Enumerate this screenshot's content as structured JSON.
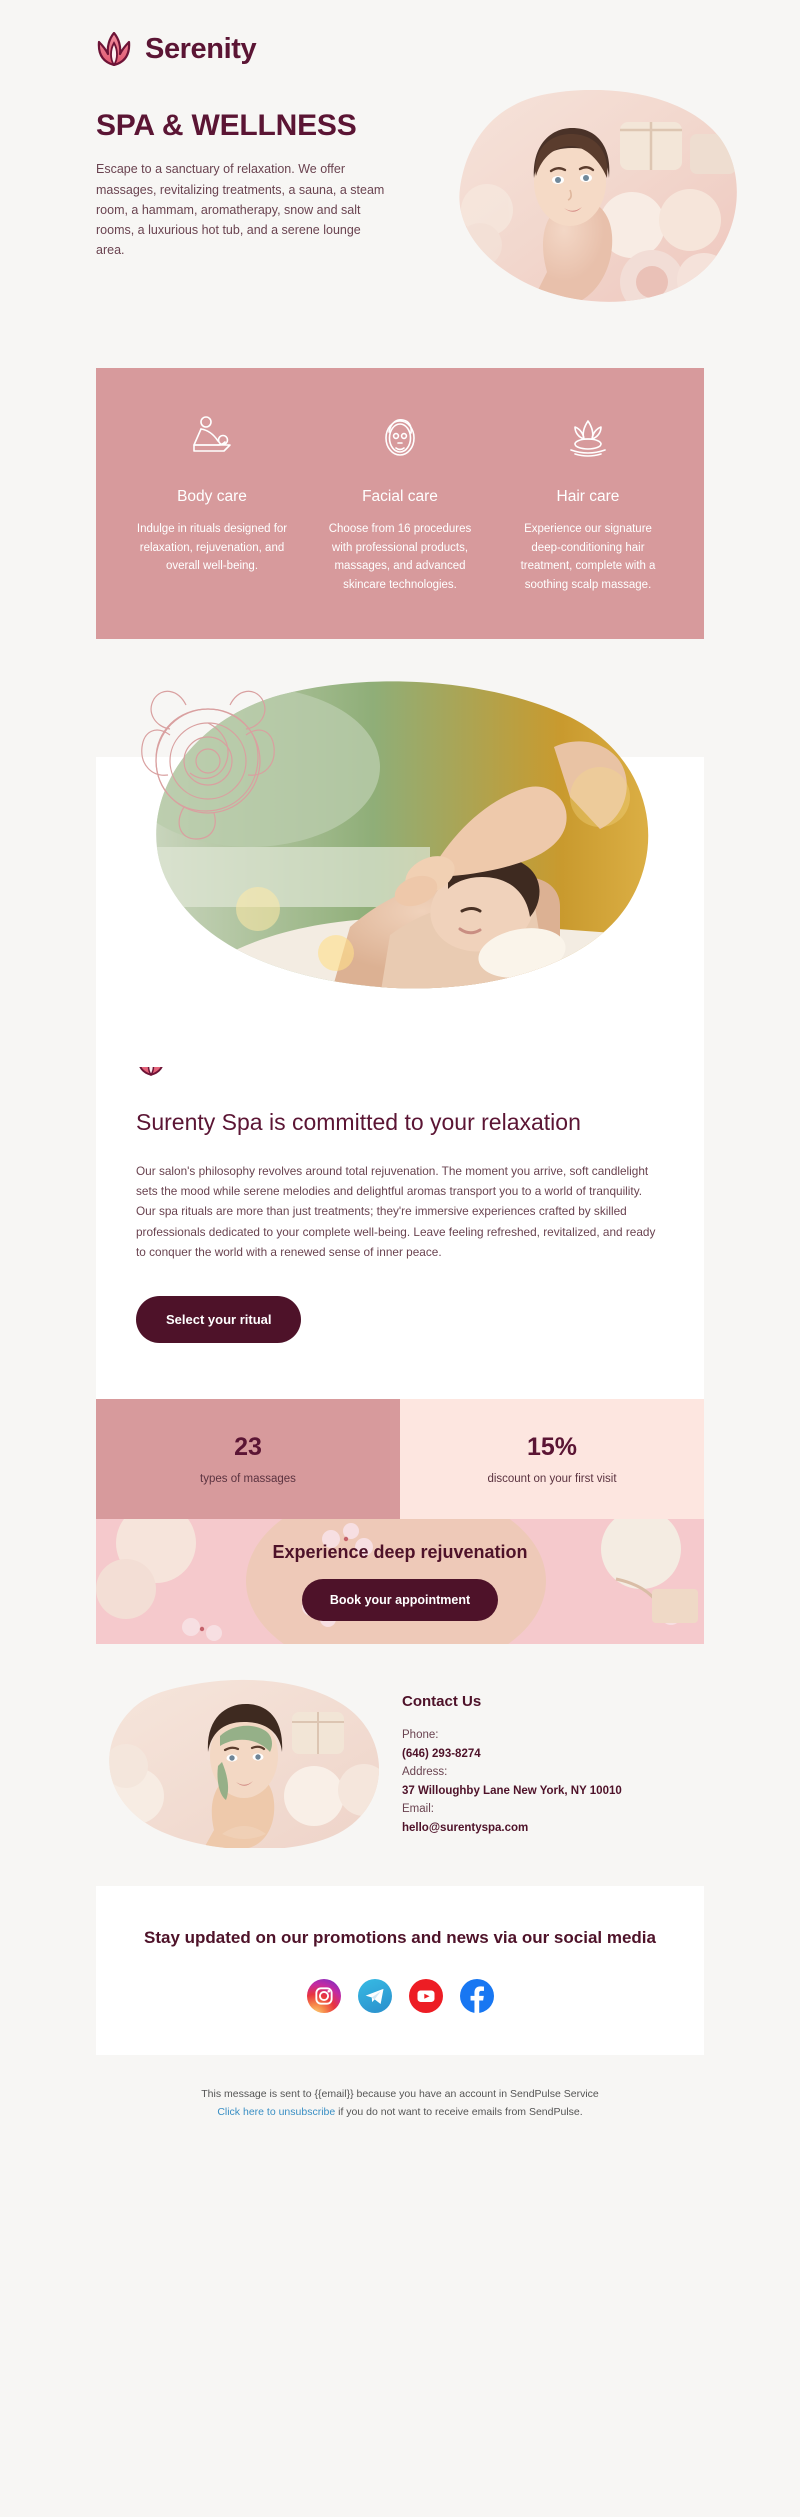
{
  "brand": {
    "name": "Serenity",
    "logo_icon": "lotus-icon",
    "accent": "#5b1534",
    "rose": "#d79a9c",
    "blush": "#fde6e0"
  },
  "hero": {
    "title": "SPA & WELLNESS",
    "text": "Escape to a sanctuary of relaxation. We offer massages, revitalizing treatments, a sauna, a steam room, a hammam, aromatherapy, snow and salt rooms, a luxurious hot tub, and a serene lounge area.",
    "image_alt": "woman-with-spa-products"
  },
  "services": [
    {
      "icon": "massage-table-icon",
      "title": "Body care",
      "desc": "Indulge in rituals designed for relaxation, rejuvenation, and overall well-being."
    },
    {
      "icon": "face-mask-icon",
      "title": "Facial care",
      "desc": "Choose from 16 procedures with professional products, massages, and advanced skincare technologies."
    },
    {
      "icon": "lotus-water-icon",
      "title": "Hair care",
      "desc": "Experience our signature deep-conditioning hair treatment, complete with a soothing scalp massage."
    }
  ],
  "massage": {
    "image_alt": "woman-receiving-back-massage",
    "decor": "rose-outline-icon"
  },
  "philosophy": {
    "icon": "lotus-icon",
    "title": "Surenty Spa is committed to your relaxation",
    "text": "Our salon's philosophy revolves around total rejuvenation. The moment you arrive, soft candlelight sets the mood while serene melodies and delightful aromas transport you to a world of tranquility. Our spa rituals are more than just treatments; they're immersive experiences crafted by skilled professionals dedicated to your complete well-being. Leave feeling refreshed, revitalized, and ready to conquer the world with a renewed sense of inner peace.",
    "cta": "Select your ritual"
  },
  "stats": [
    {
      "value": "23",
      "label": "types of massages"
    },
    {
      "value": "15%",
      "label": "discount on your first visit"
    }
  ],
  "banner": {
    "title": "Experience deep rejuvenation",
    "cta": "Book your appointment",
    "image_alt": "spa-flatlay-pink"
  },
  "contact": {
    "heading": "Contact Us",
    "phone_label": "Phone:",
    "phone": "(646) 293-8274",
    "address_label": "Address:",
    "address": "37 Willoughby Lane New York, NY 10010",
    "email_label": "Email:",
    "email": "hello@surentyspa.com",
    "image_alt": "woman-with-green-face-mask"
  },
  "social": {
    "heading": "Stay updated on our promotions and news via our social media",
    "icons": [
      {
        "name": "instagram-icon"
      },
      {
        "name": "telegram-icon"
      },
      {
        "name": "youtube-icon"
      },
      {
        "name": "facebook-icon"
      }
    ]
  },
  "footer": {
    "line1": "This message is sent to {{email}} because you have an account in SendPulse Service",
    "link": "Click here to unsubscribe",
    "line2": " if you do not want to receive emails from SendPulse."
  }
}
